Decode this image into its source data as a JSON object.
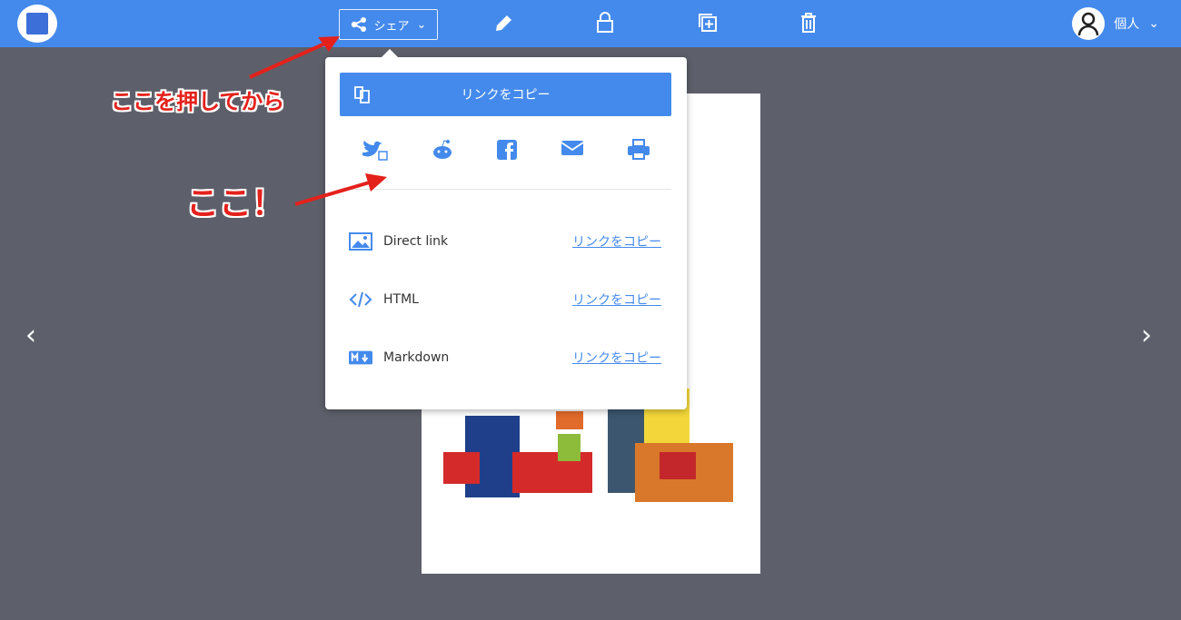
{
  "topbar": {
    "share_label": "シェア",
    "user_label": "個人"
  },
  "popover": {
    "copy_link_label": "リンクをコピー",
    "socials": [
      "twitter",
      "reddit",
      "facebook",
      "email",
      "print"
    ],
    "rows": [
      {
        "label": "Direct link",
        "action": "リンクをコピー"
      },
      {
        "label": "HTML",
        "action": "リンクをコピー"
      },
      {
        "label": "Markdown",
        "action": "リンクをコピー"
      }
    ]
  },
  "annotations": {
    "first": "ここを押してから",
    "second": "ここ！"
  },
  "colors": {
    "accent": "#448aec",
    "annotation": "#e4211b",
    "background": "#5d606a"
  }
}
